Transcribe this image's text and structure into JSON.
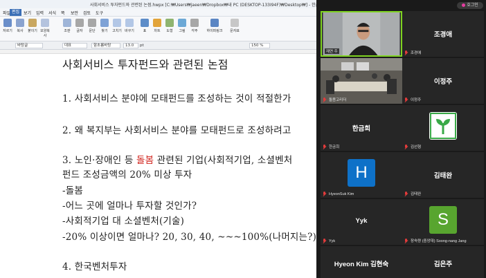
{
  "editor": {
    "window_title": "사회서비스 투자펀드와 관련된 논점.hwpx [C:₩Users₩jaeen₩Dropbox₩내 PC (DESKTOP-133I94F)₩Desktop₩] - 한글",
    "menus": [
      "파일",
      "편집",
      "보기",
      "입력",
      "서식",
      "쪽",
      "보안",
      "검토",
      "도구"
    ],
    "active_menu": "편집",
    "ribbon": [
      "자르기",
      "복사",
      "붙이기",
      "모양복사",
      "조판",
      "글자",
      "문단",
      "찾기",
      "고치기",
      "바꾸기",
      "표",
      "차트",
      "도형",
      "그림",
      "각주",
      "하이퍼링크",
      "문자표"
    ],
    "format": {
      "style": "바탕글",
      "font_type": "대표",
      "font": "함초롬바탕",
      "size": "13.0",
      "unit": "pt",
      "zoom": "150 %"
    },
    "lines": [
      {
        "text": "사회서비스 투자펀드와 관련된 논점"
      },
      {
        "text": "1. 사회서비스 분야에 모태펀드를 조성하는 것이 적절한가"
      },
      {
        "text": "2. 왜 복지부는 사회서비스 분야를 모태펀드로 조성하려고"
      },
      {
        "pre": "3. 노인·장애인 등 ",
        "red": "돌봄",
        "post": " 관련된 기업(사회적기업, 소셜벤처"
      },
      {
        "text": "펀드 조성금액의 20% 미상 투자"
      },
      {
        "text": "-돌봄"
      },
      {
        "text": "-어느 곳에 얼마나 투자할 것인가?"
      },
      {
        "text": "-사회적기업 대 소셜벤처(기술)"
      },
      {
        "text": "-20% 이상이면 얼마나? 20, 30, 40, ~~~100%(나머지는?)"
      },
      {
        "text": "4. 한국벤처투자"
      }
    ]
  },
  "zoom": {
    "top_button": "호그인",
    "participants": [
      {
        "name": "재연 주",
        "label": "재연 주",
        "video": "person",
        "active": true,
        "muted": false
      },
      {
        "name": "조경애",
        "label": "조경애",
        "muted": true
      },
      {
        "name": "돌봄고리더",
        "label": "돌봄고리더",
        "video": "room",
        "muted": true
      },
      {
        "name": "이정주",
        "label": "이정주",
        "muted": true
      },
      {
        "name": "한금희",
        "label": "한금희",
        "muted": true
      },
      {
        "name": "김선형",
        "label": "김선형",
        "avatar": "plant",
        "muted": true
      },
      {
        "name": "HyeonSuk Kim",
        "label": "HyeonSuk Kim",
        "avatar": "H",
        "avatar_color": "#0e71c8",
        "muted": true
      },
      {
        "name": "김태완",
        "label": "김태완",
        "muted": true
      },
      {
        "name": "Yyk",
        "label": "Yyk",
        "muted": true
      },
      {
        "name": "장숙량 (중앙대) Soong-nang Jang",
        "label": "장숙량 (중앙대) Soong-nang Jang",
        "avatar": "S",
        "avatar_color": "#58a52f",
        "muted": true
      },
      {
        "name": "Hyeon Kim 김현숙",
        "label": "Hyeon Kim 김현숙",
        "muted": false
      },
      {
        "name": "김은주",
        "label": "김은주",
        "muted": false
      }
    ]
  },
  "colors": {
    "accent": "#7fd321",
    "highlight_red": "#d0211b",
    "menu_active": "#3b6fb6"
  }
}
